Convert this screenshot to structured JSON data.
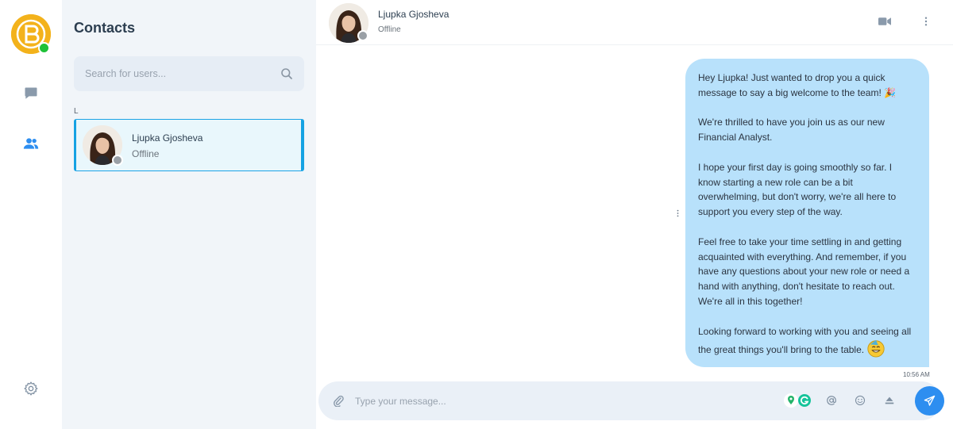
{
  "colors": {
    "accent": "#2d8ef0",
    "bubble": "#b8e1fb",
    "online": "#1ec138",
    "offline": "#9aa0a6",
    "logo": "#f3b21b",
    "active_border": "#15a2e3"
  },
  "rail": {
    "logo_icon": "brand-logo-icon",
    "items": [
      {
        "name": "chats",
        "icon": "chat-bubble-icon"
      },
      {
        "name": "contacts",
        "icon": "users-icon",
        "active": true
      },
      {
        "name": "settings",
        "icon": "gear-icon"
      }
    ]
  },
  "contacts": {
    "title": "Contacts",
    "search_placeholder": "Search for users...",
    "groups": [
      {
        "letter": "L",
        "items": [
          {
            "name": "Ljupka Gjosheva",
            "status": "Offline",
            "selected": true
          }
        ]
      }
    ]
  },
  "chat": {
    "header": {
      "name": "Ljupka Gjosheva",
      "status": "Offline"
    },
    "messages": [
      {
        "paragraphs": [
          "Hey Ljupka! Just wanted to drop you a quick message to say a big welcome to the team! 🎉",
          "We're thrilled to have you join us as our new Financial Analyst.",
          "I hope your first day is going smoothly so far. I know starting a new role can be a bit overwhelming, but don't worry, we're all here to support you every step of the way.",
          "Feel free to take your time settling in and getting acquainted with everything. And remember, if you have any questions about your new role or need a hand with anything, don't hesitate to reach out. We're all in this together!",
          "Looking forward to working with you and seeing all the great things you'll bring to the table."
        ],
        "time": "10:56 AM"
      }
    ],
    "composer": {
      "placeholder": "Type your message..."
    }
  }
}
